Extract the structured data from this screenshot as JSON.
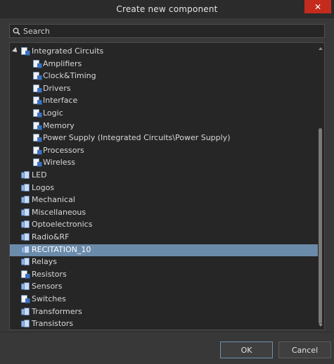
{
  "window": {
    "title": "Create new component",
    "close_glyph": "✕"
  },
  "search": {
    "placeholder": "Search",
    "value": ""
  },
  "tree": {
    "items": [
      {
        "label": "Integrated Circuits",
        "level": 0,
        "expanded": true,
        "icon": "folder-chip-icon",
        "selected": false
      },
      {
        "label": "Amplifiers",
        "level": 1,
        "icon": "component-icon",
        "selected": false
      },
      {
        "label": "Clock&Timing",
        "level": 1,
        "icon": "component-icon",
        "selected": false
      },
      {
        "label": "Drivers",
        "level": 1,
        "icon": "component-icon",
        "selected": false
      },
      {
        "label": "Interface",
        "level": 1,
        "icon": "component-icon",
        "selected": false
      },
      {
        "label": "Logic",
        "level": 1,
        "icon": "component-icon",
        "selected": false
      },
      {
        "label": "Memory",
        "level": 1,
        "icon": "component-icon",
        "selected": false
      },
      {
        "label": "Power Supply (Integrated Circuits\\Power Supply)",
        "level": 1,
        "icon": "component-icon",
        "selected": false
      },
      {
        "label": "Processors",
        "level": 1,
        "icon": "component-icon",
        "selected": false
      },
      {
        "label": "Wireless",
        "level": 1,
        "icon": "component-icon",
        "selected": false
      },
      {
        "label": "LED",
        "level": 0,
        "icon": "category-icon",
        "selected": false
      },
      {
        "label": "Logos",
        "level": 0,
        "icon": "category-icon",
        "selected": false
      },
      {
        "label": "Mechanical",
        "level": 0,
        "icon": "category-icon",
        "selected": false
      },
      {
        "label": "Miscellaneous",
        "level": 0,
        "icon": "category-icon",
        "selected": false
      },
      {
        "label": "Optoelectronics",
        "level": 0,
        "icon": "category-icon",
        "selected": false
      },
      {
        "label": "Radio&RF",
        "level": 0,
        "icon": "category-icon",
        "selected": false
      },
      {
        "label": "RECITATION_10",
        "level": 0,
        "icon": "category-icon",
        "selected": true
      },
      {
        "label": "Relays",
        "level": 0,
        "icon": "category-icon",
        "selected": false
      },
      {
        "label": "Resistors",
        "level": 0,
        "icon": "component-icon",
        "selected": false
      },
      {
        "label": "Sensors",
        "level": 0,
        "icon": "category-icon",
        "selected": false
      },
      {
        "label": "Switches",
        "level": 0,
        "icon": "component-icon",
        "selected": false
      },
      {
        "label": "Transformers",
        "level": 0,
        "icon": "category-icon",
        "selected": false
      },
      {
        "label": "Transistors",
        "level": 0,
        "icon": "category-icon",
        "selected": false
      }
    ]
  },
  "buttons": {
    "ok_label": "OK",
    "cancel_label": "Cancel"
  },
  "colors": {
    "selection": "#6b8baa",
    "close": "#c42b1c",
    "ok_border": "#6f8fb0"
  }
}
